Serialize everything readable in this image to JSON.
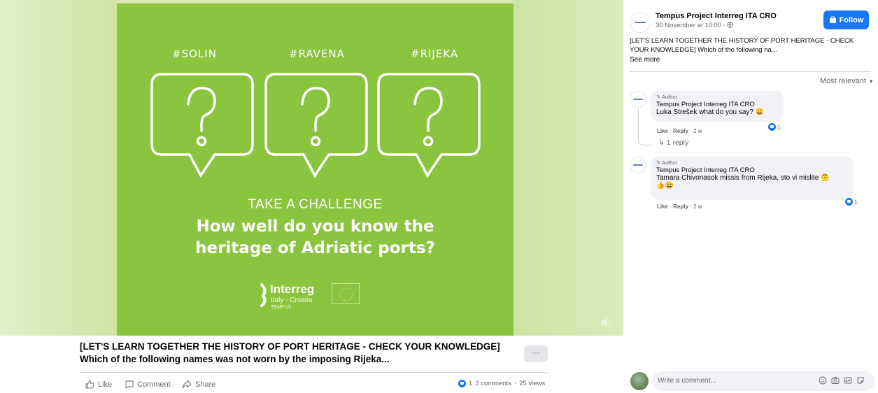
{
  "media": {
    "tags": [
      "#SOLIN",
      "#RAVENA",
      "#RIJEKA"
    ],
    "challenge_sub": "TAKE A CHALLENGE",
    "challenge_title_1": "How well do you know the",
    "challenge_title_2": "heritage of Adriatic ports?",
    "logo_name": "Interreg",
    "logo_region": "Italy - Croatia",
    "logo_project": "TEMPUS",
    "poster_color": "#8bc43f"
  },
  "post": {
    "caption": "[LET'S LEARN TOGETHER THE HISTORY OF PORT HERITAGE - CHECK YOUR KNOWLEDGE] Which of the following names was not worn by the imposing Rijeka...",
    "more_label": "···",
    "actions": {
      "like": "Like",
      "comment": "Comment",
      "share": "Share"
    },
    "reaction_count": "1",
    "comments_count": "3 comments",
    "views": "25 views"
  },
  "panel": {
    "page_name": "Tempus Project Interreg ITA CRO",
    "post_time": "30 November at 10:00 ·",
    "follow_label": "Follow",
    "caption": "[LET'S LEARN TOGETHER THE HISTORY OF PORT HERITAGE - CHECK YOUR KNOWLEDGE] Which of the following na...",
    "see_more": "See more",
    "sort_label": "Most relevant",
    "comments": [
      {
        "author_tag": "Author",
        "name": "Tempus Project Interreg ITA CRO",
        "text": "Luka Strešek what do you say? 😀",
        "like": "Like",
        "reply": "Reply",
        "age": "2 w",
        "reactions": "1"
      },
      {
        "author_tag": "Author",
        "name": "Tempus Project Interreg ITA CRO",
        "text": "Tamara Chivonasok missis from Rijeka, sto vi mislite 🤔",
        "text2": "👍😀",
        "like": "Like",
        "reply": "Reply",
        "age": "2 w",
        "reactions": "1"
      }
    ],
    "reply_toggle": "↳ 1 reply",
    "composer_placeholder": "Write a comment..."
  }
}
